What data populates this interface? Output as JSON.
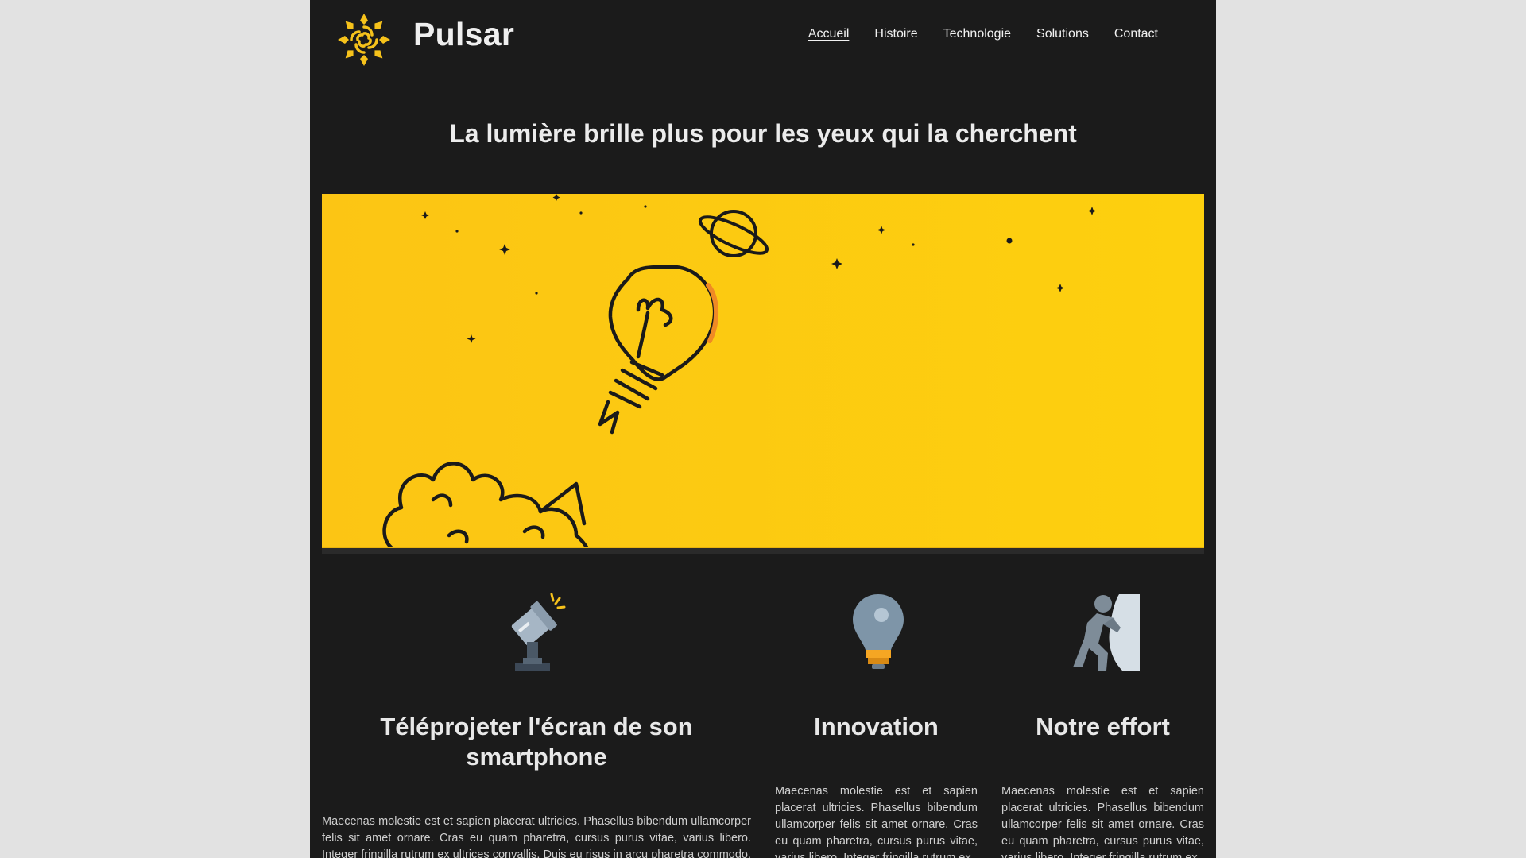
{
  "brand": {
    "name": "Pulsar"
  },
  "nav": {
    "items": [
      "Accueil",
      "Histoire",
      "Technologie",
      "Solutions",
      "Contact"
    ]
  },
  "tagline": "La lumière brille plus pour les yeux qui la cherchent",
  "colors": {
    "accent": "#fcc514",
    "background": "#1b1b1b",
    "page_bg": "#e2e2e2"
  },
  "features": [
    {
      "icon": "projector-icon",
      "title": "Téléprojeter l'écran de son smartphone",
      "text": "Maecenas molestie est et sapien placerat ultricies. Phasellus bibendum ullamcorper felis sit amet ornare. Cras eu quam pharetra, cursus purus vitae, varius libero. Integer fringilla rutrum ex ultrices convallis. Duis eu risus in arcu pharetra commodo. Donec"
    },
    {
      "icon": "lightbulb-icon",
      "title": "Innovation",
      "text": "Maecenas molestie est et sapien placerat ultricies. Phasellus bibendum ullamcorper felis sit amet ornare. Cras eu quam pharetra, cursus purus vitae, varius libero. Integer fringilla rutrum ex"
    },
    {
      "icon": "person-pushing-icon",
      "title": "Notre effort",
      "text": "Maecenas molestie est et sapien placerat ultricies. Phasellus bibendum ullamcorper felis sit amet ornare. Cras eu quam pharetra, cursus purus vitae, varius libero. Integer fringilla rutrum ex"
    }
  ]
}
